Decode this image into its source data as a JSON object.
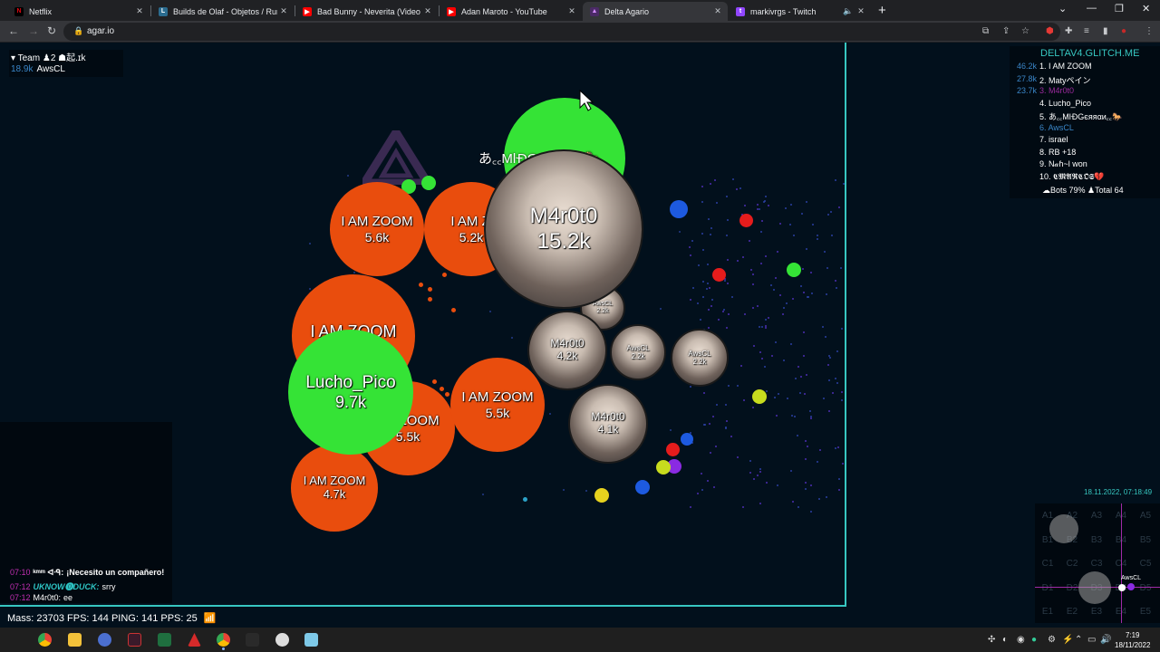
{
  "browser": {
    "tabs": [
      {
        "title": "Netflix",
        "icon": "netflix-icon",
        "color": "#e50914",
        "glyph": "N"
      },
      {
        "title": "Builds de Olaf - Objetos / Runas",
        "icon": "league-icon",
        "color": "#2b6c8f",
        "glyph": "L"
      },
      {
        "title": "Bad Bunny - Neverita (Video Ofic",
        "icon": "youtube-icon",
        "color": "#ff0000",
        "glyph": "▶"
      },
      {
        "title": "Adan Maroto - YouTube",
        "icon": "youtube-icon",
        "color": "#ff0000",
        "glyph": "▶"
      },
      {
        "title": "Delta Agario",
        "icon": "delta-icon",
        "color": "#9b59b6",
        "glyph": "▲"
      },
      {
        "title": "markivrgs - Twitch",
        "icon": "twitch-icon",
        "color": "#9146ff",
        "glyph": "t"
      }
    ],
    "url": "agar.io"
  },
  "team": {
    "header": "▾ Team ♟2 ☗起.ɪk",
    "member": {
      "mass": "18.9k",
      "name": "AwsCL"
    }
  },
  "leaderboard": {
    "title": "DELTAV4.GLITCH.ME",
    "rows": [
      {
        "score": "46.2k",
        "name": "1. I AM ZOOM",
        "color": "#ffffff"
      },
      {
        "score": "27.8k",
        "name": "2. Matyペイン",
        "color": "#ffffff"
      },
      {
        "score": "23.7k",
        "name": "3. M4r0t0",
        "color": "#9c2a9e"
      },
      {
        "score": "",
        "name": "4. Lucho_Pico",
        "color": "#ffffff"
      },
      {
        "score": "",
        "name": "5. あ꜀꜀MŀĐGєяяαи꜀꜀🐎",
        "color": "#ffffff"
      },
      {
        "score": "",
        "name": "6. AwsCL",
        "color": "#3a85c7"
      },
      {
        "score": "",
        "name": "7. israel",
        "color": "#ffffff"
      },
      {
        "score": "",
        "name": "8. RB +18",
        "color": "#ffffff"
      },
      {
        "score": "",
        "name": "9. N𝒶ɦ~l won",
        "color": "#ffffff"
      },
      {
        "score": "",
        "name": "10. 𝕮𝕸𝕬𝕽𝕮𝕺𝕾💔",
        "color": "#ffffff"
      }
    ],
    "stats": "☁Bots 79% ♟Total 64"
  },
  "cells": [
    {
      "name": "I AM ZOOM",
      "mass": "5.6k",
      "kind": "orange"
    },
    {
      "name": "I AM ZOOM",
      "mass": "5.2k",
      "kind": "orange"
    },
    {
      "name": "I AM ZOOM",
      "mass": "",
      "kind": "orange"
    },
    {
      "name": "I AM ZOOM",
      "mass": "5.5k",
      "kind": "orange"
    },
    {
      "name": "I AM ZOOM",
      "mass": "5.5k",
      "kind": "orange"
    },
    {
      "name": "I AM ZOOM",
      "mass": "4.7k",
      "kind": "orange"
    },
    {
      "name": "Lucho_Pico",
      "mass": "9.7k",
      "kind": "green"
    },
    {
      "name": "あ꜀꜀MŀĐGєяяαи꜀꜀🐎",
      "mass": "",
      "kind": "green"
    },
    {
      "name": "M4r0t0",
      "mass": "15.2k",
      "kind": "skin"
    },
    {
      "name": "M4r0t0",
      "mass": "4.2k",
      "kind": "skin"
    },
    {
      "name": "M4r0t0",
      "mass": "4.1k",
      "kind": "skin"
    },
    {
      "name": "AwsCL",
      "mass": "2.2k",
      "kind": "skin"
    },
    {
      "name": "AwsCL",
      "mass": "2.2k",
      "kind": "skin"
    },
    {
      "name": "AwsCL",
      "mass": "2.2k",
      "kind": "skin"
    }
  ],
  "chat": [
    {
      "time": "07:10",
      "who": "ᵏᵐᵐ ᐊᐧᑫ:",
      "msg": "¡Necesito un compañero!",
      "color": "#ffffff"
    },
    {
      "time": "07:12",
      "who": "UKNOW🅓DUCK:",
      "msg": "srry",
      "color": "#2ec4c4"
    },
    {
      "time": "07:12",
      "who": "M4r0t0:",
      "msg": "ee",
      "color": "#ffffff"
    }
  ],
  "status": "Mass: 23703 FPS: 144 PING: 141 PPS: 25",
  "datetime": "18.11.2022, 07:18:49",
  "minimap": {
    "rows": [
      [
        "A1",
        "A2",
        "A3",
        "A4",
        "A5"
      ],
      [
        "B1",
        "B2",
        "B3",
        "B4",
        "B5"
      ],
      [
        "C1",
        "C2",
        "C3",
        "C4",
        "C5"
      ],
      [
        "D1",
        "D2",
        "D3",
        "D4",
        "D5"
      ],
      [
        "E1",
        "E2",
        "E3",
        "E4",
        "E5"
      ]
    ],
    "player_label": "AwsCL"
  },
  "taskbar": {
    "time": "7:19",
    "date": "18/11/2022"
  }
}
